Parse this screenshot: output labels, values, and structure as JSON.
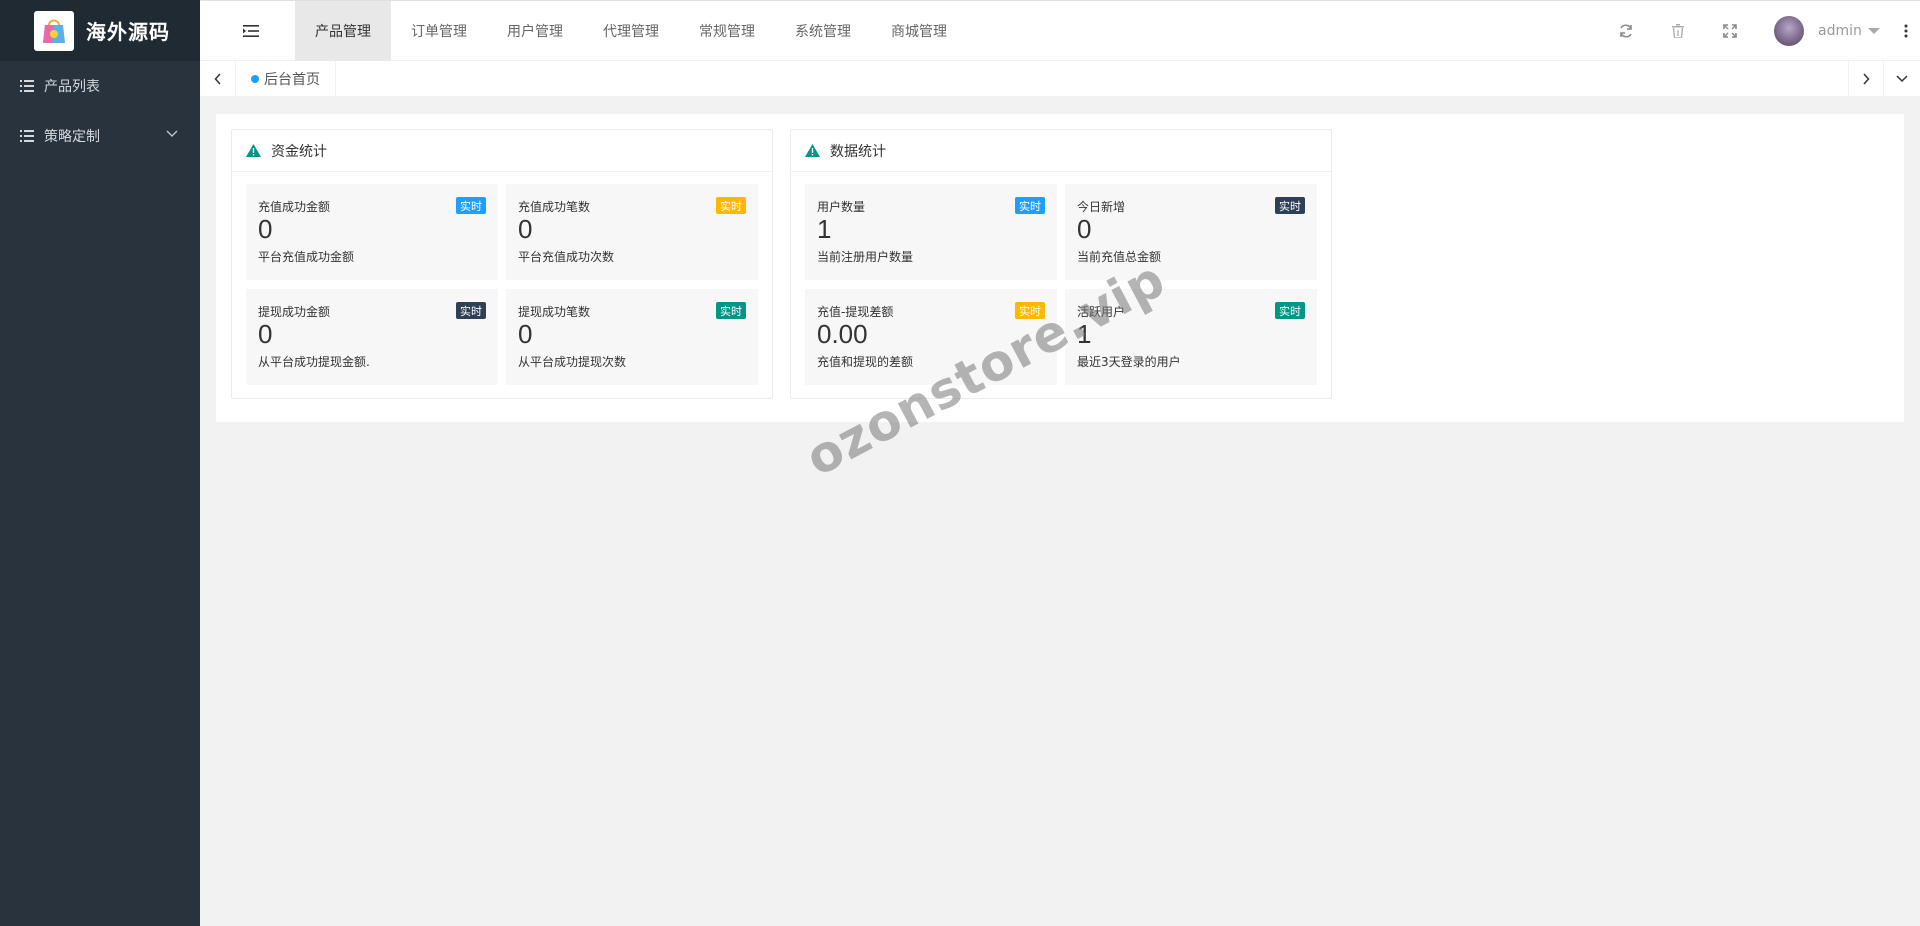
{
  "app": {
    "logo_text": "海外源码"
  },
  "sidebar": {
    "items": [
      {
        "label": "产品列表",
        "icon": "list-icon"
      },
      {
        "label": "策略定制",
        "icon": "list-icon",
        "has_submenu": true
      }
    ]
  },
  "header": {
    "nav": [
      {
        "label": "产品管理",
        "active": true
      },
      {
        "label": "订单管理"
      },
      {
        "label": "用户管理"
      },
      {
        "label": "代理管理"
      },
      {
        "label": "常规管理"
      },
      {
        "label": "系统管理"
      },
      {
        "label": "商城管理"
      }
    ],
    "icons": [
      "refresh-icon",
      "trash-icon",
      "fullscreen-icon",
      "more-vertical-icon"
    ],
    "username": "admin"
  },
  "tabs": {
    "home_label": "后台首页"
  },
  "panels": [
    {
      "title": "资金统计",
      "stats": [
        {
          "title": "充值成功金额",
          "value": "0",
          "desc": "平台充值成功金额",
          "badge": "实时",
          "badge_color": "#1e9fff"
        },
        {
          "title": "充值成功笔数",
          "value": "0",
          "desc": "平台充值成功次数",
          "badge": "实时",
          "badge_color": "#ffb800"
        },
        {
          "title": "提现成功金额",
          "value": "0",
          "desc": "从平台成功提现金额.",
          "badge": "实时",
          "badge_color": "#2f4056"
        },
        {
          "title": "提现成功笔数",
          "value": "0",
          "desc": "从平台成功提现次数",
          "badge": "实时",
          "badge_color": "#009688"
        }
      ]
    },
    {
      "title": "数据统计",
      "stats": [
        {
          "title": "用户数量",
          "value": "1",
          "desc": "当前注册用户数量",
          "badge": "实时",
          "badge_color": "#1e9fff"
        },
        {
          "title": "今日新增",
          "value": "0",
          "desc": "当前充值总金额",
          "badge": "实时",
          "badge_color": "#2f4056"
        },
        {
          "title": "充值-提现差额",
          "value": "0.00",
          "desc": "充值和提现的差额",
          "badge": "实时",
          "badge_color": "#ffb800"
        },
        {
          "title": "活跃用户",
          "value": "1",
          "desc": "最近3天登录的用户",
          "badge": "实时",
          "badge_color": "#009688"
        }
      ]
    }
  ],
  "watermark": "ozonstore.vip"
}
